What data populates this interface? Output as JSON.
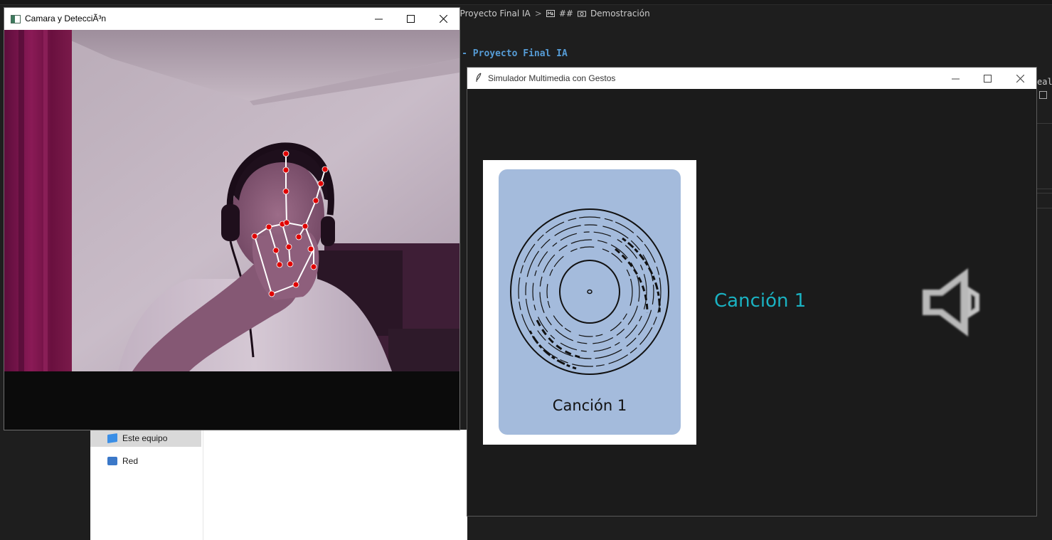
{
  "background": {
    "breadcrumb": {
      "parent": "adora - Proyecto Final IA",
      "sep": ">",
      "hash": "##",
      "section": "Demostración"
    },
    "heading": "dora - Proyecto Final IA",
    "right_fragment": "eali"
  },
  "explorer": {
    "nav_items": [
      {
        "label": "Este equipo",
        "icon": "computer-icon"
      },
      {
        "label": "Red",
        "icon": "network-icon"
      }
    ]
  },
  "camera_window": {
    "title": "Camara y DetecciÃ³n",
    "icon": "camera-app-icon",
    "controls": {
      "minimize": "minimize-icon",
      "maximize": "maximize-icon",
      "close": "close-icon"
    },
    "landmark_color": "#e00000",
    "connection_color": "#ffffff"
  },
  "multimedia_window": {
    "title": "Simulador Multimedia con Gestos",
    "icon": "feather-icon",
    "card_label": "Canción 1",
    "song_title": "Canción 1",
    "song_title_color": "#1ab2c2",
    "card_color": "#a4bbdc",
    "album_art": "vinyl-record-icon",
    "volume_icon": "speaker-muted-icon"
  }
}
